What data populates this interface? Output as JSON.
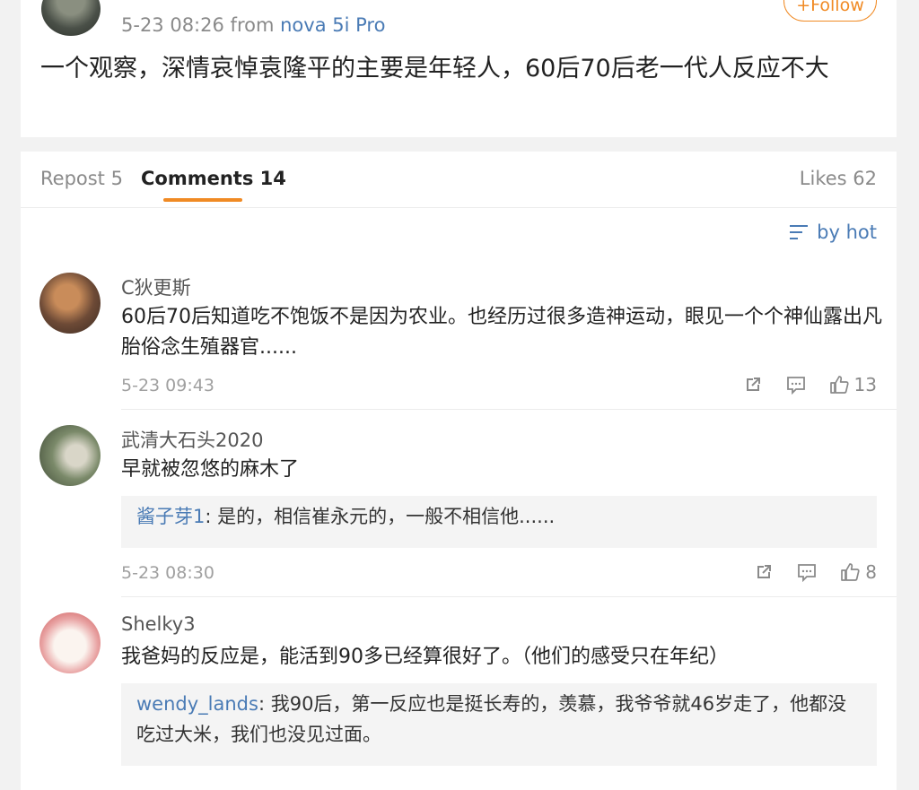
{
  "post": {
    "meta_time": "5-23 08:26",
    "meta_from": "from",
    "meta_source": "nova 5i Pro",
    "follow_label": "+Follow",
    "text": "一个观察，深情哀悼袁隆平的主要是年轻人，60后70后老一代人反应不大"
  },
  "tabs": {
    "repost": "Repost 5",
    "comments": "Comments 14",
    "likes": "Likes 62"
  },
  "sort_label": "by hot",
  "comments": [
    {
      "name": "C狄更斯",
      "text": "60后70后知道吃不饱饭不是因为农业。也经历过很多造神运动，眼见一个个神仙露出凡胎俗念生殖器官......",
      "time": "5-23 09:43",
      "likes": "13"
    },
    {
      "name": "武清大石头2020",
      "text": "早就被忽悠的麻木了",
      "reply_user": "酱子芽1",
      "reply_text": ": 是的，相信崔永元的，一般不相信他......",
      "time": "5-23 08:30",
      "likes": "8"
    },
    {
      "name": "Shelky3",
      "text": "我爸妈的反应是，能活到90多已经算很好了。（他们的感受只在年纪）",
      "reply_user": "wendy_lands",
      "reply_text": ": 我90后，第一反应也是挺长寿的，羡慕，我爷爷就46岁走了，他都没吃过大米，我们也没见过面。"
    }
  ],
  "colors": {
    "accent": "#f08a24",
    "link": "#4a7bb5"
  },
  "icons": [
    "share-icon",
    "comment-icon",
    "like-icon",
    "sort-icon"
  ]
}
